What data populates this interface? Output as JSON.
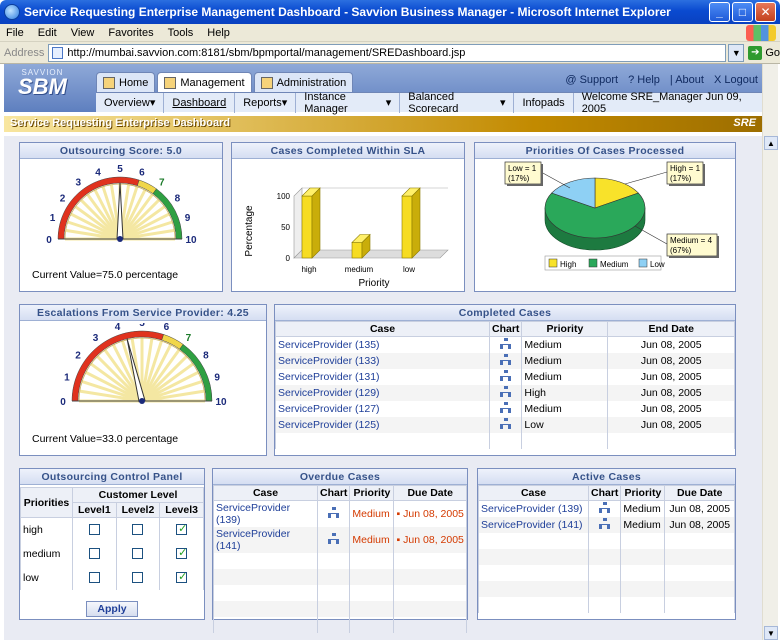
{
  "window": {
    "title": "Service Requesting Enterprise Management Dashboard - Savvion Business Manager - Microsoft Internet Explorer"
  },
  "menu": [
    "File",
    "Edit",
    "View",
    "Favorites",
    "Tools",
    "Help"
  ],
  "address": {
    "label": "Address",
    "url": "http://mumbai.savvion.com:8181/sbm/bpmportal/management/SREDashboard.jsp",
    "go": "Go"
  },
  "brand": {
    "top": "SAVVION",
    "name": "SBM"
  },
  "tabs": [
    "Home",
    "Management",
    "Administration"
  ],
  "toplinks": [
    "@ Support",
    "? Help",
    "| About",
    "X Logout"
  ],
  "subnav": [
    "Overview",
    "Dashboard",
    "Reports",
    "Instance Manager",
    "Balanced Scorecard",
    "Infopads"
  ],
  "welcome": "Welcome SRE_Manager  Jun 09, 2005",
  "banner": {
    "title": "Service Requesting Enterprise Dashboard",
    "logo": "SRE"
  },
  "outsourcing_score": {
    "title": "Outsourcing Score: 5.0",
    "value": 5.0,
    "caption": "Current Value=75.0 percentage",
    "ticks": [
      "0",
      "1",
      "2",
      "3",
      "4",
      "5",
      "6",
      "7",
      "8",
      "9",
      "10"
    ]
  },
  "escalations": {
    "title": "Escalations From Service Provider: 4.25",
    "value": 4.25,
    "caption": "Current Value=33.0 percentage",
    "ticks": [
      "0",
      "1",
      "2",
      "3",
      "4",
      "5",
      "6",
      "7",
      "8",
      "9",
      "10"
    ]
  },
  "chart_data": [
    {
      "type": "bar",
      "title": "Cases Completed Within SLA",
      "categories": [
        "high",
        "medium",
        "low"
      ],
      "values": [
        100,
        25,
        100
      ],
      "xlabel": "Priority",
      "ylabel": "Percentage",
      "ylim": [
        0,
        100
      ],
      "yticks": [
        "0",
        "50",
        "100"
      ]
    },
    {
      "type": "pie",
      "title": "Priorities Of Cases Processed",
      "labels": [
        "High",
        "Medium",
        "Low"
      ],
      "values": [
        1,
        4,
        1
      ],
      "percents": [
        "17%",
        "67%",
        "17%"
      ],
      "callouts": [
        "High = 1\n(17%)",
        "Medium = 4\n(67%)",
        "Low = 1\n(17%)"
      ],
      "colors": [
        "#f8e22a",
        "#2aa85a",
        "#8ed0f4"
      ],
      "legend": "bottom"
    }
  ],
  "completed": {
    "title": "Completed Cases",
    "headers": [
      "Case",
      "Chart",
      "Priority",
      "End Date"
    ],
    "rows": [
      [
        "ServiceProvider (135)",
        "Medium",
        "Jun 08, 2005"
      ],
      [
        "ServiceProvider (133)",
        "Medium",
        "Jun 08, 2005"
      ],
      [
        "ServiceProvider (131)",
        "Medium",
        "Jun 08, 2005"
      ],
      [
        "ServiceProvider (129)",
        "High",
        "Jun 08, 2005"
      ],
      [
        "ServiceProvider (127)",
        "Medium",
        "Jun 08, 2005"
      ],
      [
        "ServiceProvider (125)",
        "Low",
        "Jun 08, 2005"
      ]
    ]
  },
  "control": {
    "title": "Outsourcing Control Panel",
    "col_priorities": "Priorities",
    "col_group": "Customer Level",
    "levels": [
      "Level1",
      "Level2",
      "Level3"
    ],
    "rows": [
      {
        "name": "high",
        "checks": [
          false,
          false,
          true
        ]
      },
      {
        "name": "medium",
        "checks": [
          false,
          false,
          true
        ]
      },
      {
        "name": "low",
        "checks": [
          false,
          false,
          true
        ]
      }
    ],
    "apply": "Apply"
  },
  "overdue": {
    "title": "Overdue Cases",
    "headers": [
      "Case",
      "Chart",
      "Priority",
      "Due Date"
    ],
    "rows": [
      [
        "ServiceProvider (139)",
        "Medium",
        "Jun 08, 2005"
      ],
      [
        "ServiceProvider (141)",
        "Medium",
        "Jun 08, 2005"
      ]
    ]
  },
  "active": {
    "title": "Active Cases",
    "headers": [
      "Case",
      "Chart",
      "Priority",
      "Due Date"
    ],
    "rows": [
      [
        "ServiceProvider (139)",
        "Medium",
        "Jun 08, 2005"
      ],
      [
        "ServiceProvider (141)",
        "Medium",
        "Jun 08, 2005"
      ]
    ]
  }
}
